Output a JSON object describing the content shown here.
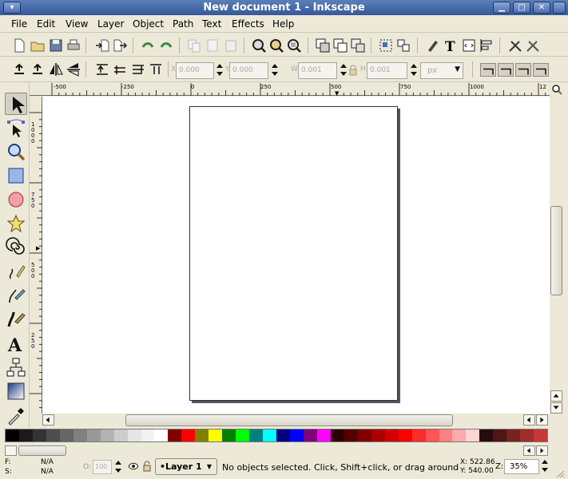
{
  "window": {
    "title": "New document 1 - Inkscape"
  },
  "menu": [
    {
      "label": "File"
    },
    {
      "label": "Edit"
    },
    {
      "label": "View"
    },
    {
      "label": "Layer"
    },
    {
      "label": "Object"
    },
    {
      "label": "Path"
    },
    {
      "label": "Text"
    },
    {
      "label": "Effects"
    },
    {
      "label": "Help"
    }
  ],
  "controls": {
    "x_label": "X",
    "x_value": "0.000",
    "y_label": "Y",
    "y_value": "0.000",
    "w_label": "W",
    "w_value": "0.001",
    "h_label": "H",
    "h_value": "0.001",
    "unit": "px"
  },
  "ruler": {
    "h_labels": [
      "-500",
      "-250",
      "0",
      "250",
      "500",
      "750",
      "1000",
      "12"
    ],
    "v_labels": [
      "1000",
      "750",
      "500",
      "250"
    ]
  },
  "tools": [
    {
      "icon": "selector-arrow-icon"
    },
    {
      "icon": "node-edit-icon"
    },
    {
      "icon": "zoom-tool-icon"
    },
    {
      "icon": "rectangle-tool-icon"
    },
    {
      "icon": "ellipse-tool-icon"
    },
    {
      "icon": "star-tool-icon"
    },
    {
      "icon": "spiral-tool-icon"
    },
    {
      "icon": "pencil-tool-icon"
    },
    {
      "icon": "pen-tool-icon"
    },
    {
      "icon": "calligraphy-tool-icon"
    },
    {
      "icon": "text-tool-icon"
    },
    {
      "icon": "connector-tool-icon"
    },
    {
      "icon": "gradient-tool-icon"
    },
    {
      "icon": "dropper-tool-icon"
    }
  ],
  "palette": [
    "#000000",
    "#1a1a1a",
    "#333333",
    "#4d4d4d",
    "#666666",
    "#808080",
    "#999999",
    "#b3b3b3",
    "#cccccc",
    "#e6e6e6",
    "#f2f2f2",
    "#ffffff",
    "#800000",
    "#ff0000",
    "#808000",
    "#ffff00",
    "#008000",
    "#00ff00",
    "#008080",
    "#00ffff",
    "#000080",
    "#0000ff",
    "#800080",
    "#ff00ff",
    "#2b0000",
    "#550000",
    "#800000",
    "#aa0000",
    "#d40000",
    "#ff0000",
    "#ff2a2a",
    "#ff5555",
    "#ff8080",
    "#ffaaaa",
    "#ffd5d5",
    "#280b0b",
    "#501616",
    "#782121",
    "#a02c2c",
    "#c83737"
  ],
  "status": {
    "fill_label": "F:",
    "fill_value": "N/A",
    "stroke_label": "S:",
    "stroke_value": "N/A",
    "opacity_label": "O:",
    "opacity_value": "100",
    "layer": "•Layer 1",
    "message": "No objects selected. Click, Shift+click, or drag around",
    "coord_x": "X: 522.86",
    "coord_y": "Y: 540.00",
    "zoom_label": "Z:",
    "zoom_value": "35%"
  }
}
